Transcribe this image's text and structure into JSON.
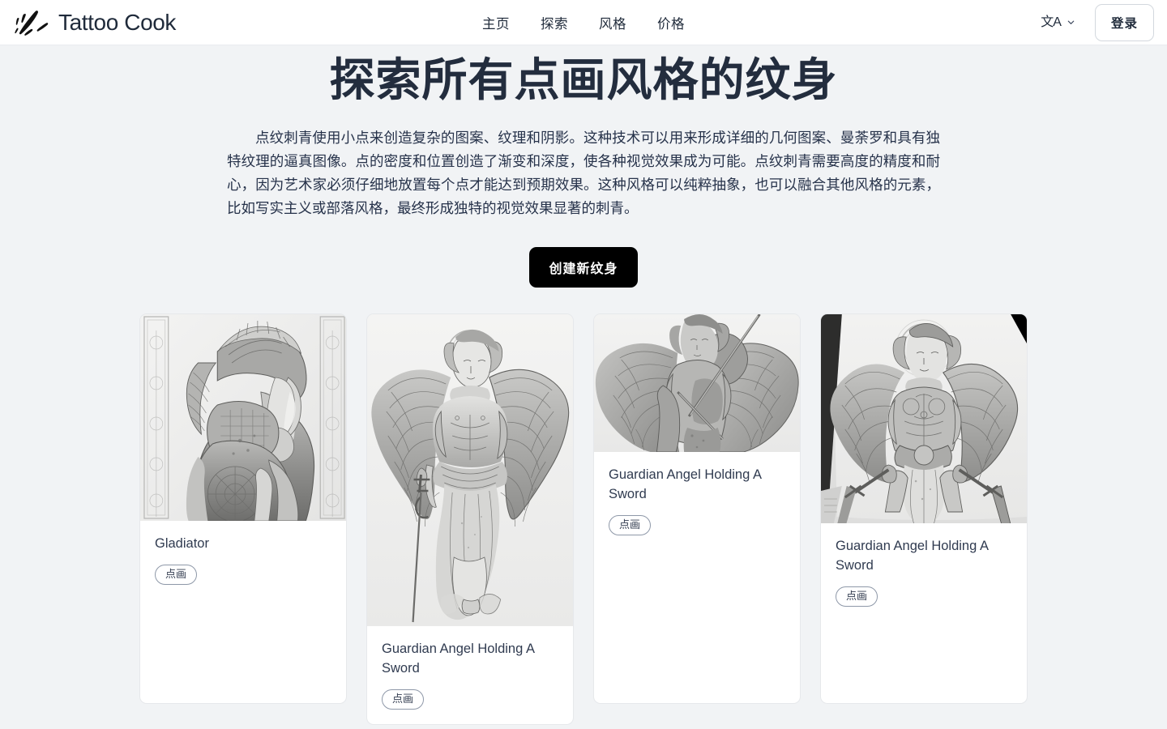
{
  "header": {
    "brand_name": "Tattoo Cook",
    "logo_icon": "ink-splatter-logo",
    "nav": [
      {
        "label": "主页",
        "name": "nav-item-home"
      },
      {
        "label": "探索",
        "name": "nav-item-explore"
      },
      {
        "label": "风格",
        "name": "nav-item-styles"
      },
      {
        "label": "价格",
        "name": "nav-item-pricing"
      }
    ],
    "language_glyph": "文A",
    "language_icon": "language-icon",
    "chevron_icon": "chevron-down-icon",
    "login_label": "登录"
  },
  "hero": {
    "title": "探索所有点画风格的纹身",
    "description": "点纹刺青使用小点来创造复杂的图案、纹理和阴影。这种技术可以用来形成详细的几何图案、曼荼罗和具有独特纹理的逼真图像。点的密度和位置创造了渐变和深度，使各种视觉效果成为可能。点纹刺青需要高度的精度和耐心，因为艺术家必须仔细地放置每个点才能达到预期效果。这种风格可以纯粹抽象，也可以融合其他风格的元素，比如写实主义或部落风格，最终形成独特的视觉效果显著的刺青。",
    "cta_label": "创建新纹身"
  },
  "gallery": {
    "cards": [
      {
        "title": "Gladiator",
        "badge": "点画",
        "art": "gladiator-profile-helmet-drawing",
        "art_height": 255
      },
      {
        "title": "Guardian Angel Holding A Sword",
        "badge": "点画",
        "art": "winged-angel-with-sword-drawing",
        "art_height": 385
      },
      {
        "title": "Guardian Angel Holding A Sword",
        "badge": "点画",
        "art": "wide-winged-angel-drawing",
        "art_height": 170
      },
      {
        "title": "Guardian Angel Holding A Sword",
        "badge": "点画",
        "art": "female-angel-two-swords-drawing",
        "art_height": 258
      }
    ]
  },
  "colors": {
    "page_background": "#f1f3f5",
    "header_background": "#ffffff",
    "text_primary": "#1f2a3a",
    "cta_background": "#000000",
    "cta_text": "#ffffff",
    "card_background": "#ffffff",
    "card_border": "#e6e8eb"
  }
}
